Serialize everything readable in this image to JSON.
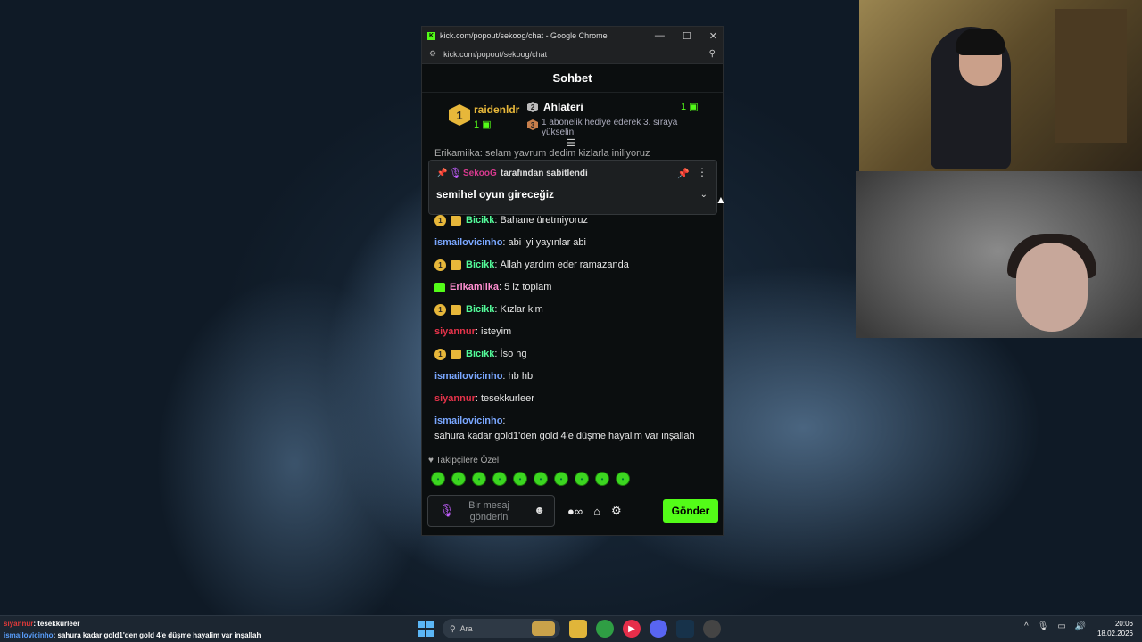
{
  "browser": {
    "window_title": "kick.com/popout/sekoog/chat - Google Chrome",
    "url": "kick.com/popout/sekoog/chat",
    "minimize": "—",
    "maximize": "☐",
    "close": "✕"
  },
  "chat": {
    "header": "Sohbet",
    "leaderboard": {
      "first_rank": "1",
      "first_name": "raidenldr",
      "first_count": "1",
      "second_rank": "2",
      "second_name": "Ahlateri",
      "second_count": "1",
      "third_rank": "3",
      "hint": "1 abonelik hediye ederek 3. sıraya yükselin"
    },
    "cut_line": "Erikamiika: selam yavrum dedim kizlarla iniliyoruz",
    "pinned": {
      "author": "SekooG",
      "by_text": "tarafından sabitlendi",
      "text": "semihel oyun gireceğiz"
    },
    "messages": [
      {
        "badges": [
          "gold1",
          "gift"
        ],
        "user": "Bicikk",
        "color": "#53fc9a",
        "text": "Bahane üretmiyoruz"
      },
      {
        "badges": [],
        "user": "ismailovicinho",
        "color": "#7aa7ff",
        "text": "abi iyi yayınlar abi"
      },
      {
        "badges": [
          "gold1",
          "gift"
        ],
        "user": "Bicikk",
        "color": "#53fc9a",
        "text": "Allah yardım eder ramazanda"
      },
      {
        "badges": [
          "giftgreen"
        ],
        "user": "Erikamiika",
        "color": "#ff8fd0",
        "text": "5 iz toplam"
      },
      {
        "badges": [
          "gold1",
          "gift"
        ],
        "user": "Bicikk",
        "color": "#53fc9a",
        "text": "Kızlar kim"
      },
      {
        "badges": [],
        "user": "siyannur",
        "color": "#e5334a",
        "text": "isteyim"
      },
      {
        "badges": [
          "gold1",
          "gift"
        ],
        "user": "Bicikk",
        "color": "#53fc9a",
        "text": "İso hg"
      },
      {
        "badges": [],
        "user": "ismailovicinho",
        "color": "#7aa7ff",
        "text": "hb hb"
      },
      {
        "badges": [],
        "user": "siyannur",
        "color": "#e5334a",
        "text": "tesekkurleer"
      },
      {
        "badges": [],
        "user": "ismailovicinho",
        "color": "#7aa7ff",
        "text": "sahura kadar gold1'den gold 4'e düşme hayalim var inşallah"
      }
    ],
    "followers_label": "Takipçilere Özel",
    "input_placeholder": "Bir mesaj gönderin",
    "send_label": "Gönder"
  },
  "taskbar": {
    "overlay_chat": [
      {
        "user": "siyannur",
        "text": ": tesekkurleer"
      },
      {
        "user": "ismailovicinho",
        "text": ": sahura kadar gold1'den gold 4'e düşme hayalim var inşallah"
      }
    ],
    "search_label": "Ara",
    "time": "20:06",
    "date": "18.02.2026"
  }
}
